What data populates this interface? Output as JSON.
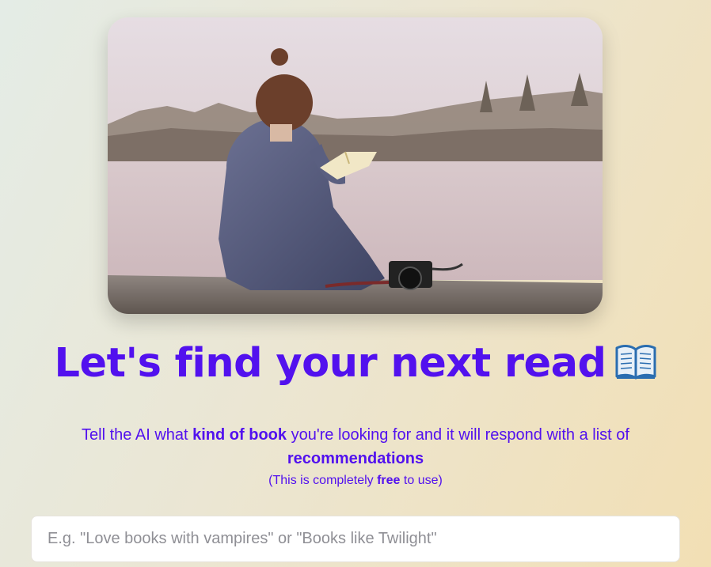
{
  "hero": {
    "image_alt": "Woman sitting by the water reading a book with a camera beside her"
  },
  "headline": {
    "text": "Let's find your next read",
    "emoji_icon": "open-book-icon"
  },
  "description": {
    "part1": "Tell the AI what ",
    "bold1": "kind of book",
    "part2": " you're looking for and it will respond with a list of ",
    "bold2": "recommendations"
  },
  "note": {
    "prefix": "(This is completely ",
    "bold": "free",
    "suffix": " to use)"
  },
  "search": {
    "placeholder": "E.g. \"Love books with vampires\" or \"Books like Twilight\"",
    "value": ""
  },
  "colors": {
    "accent": "#5211ee",
    "background_start": "#e4ece6",
    "background_end": "#f2dfb4"
  }
}
